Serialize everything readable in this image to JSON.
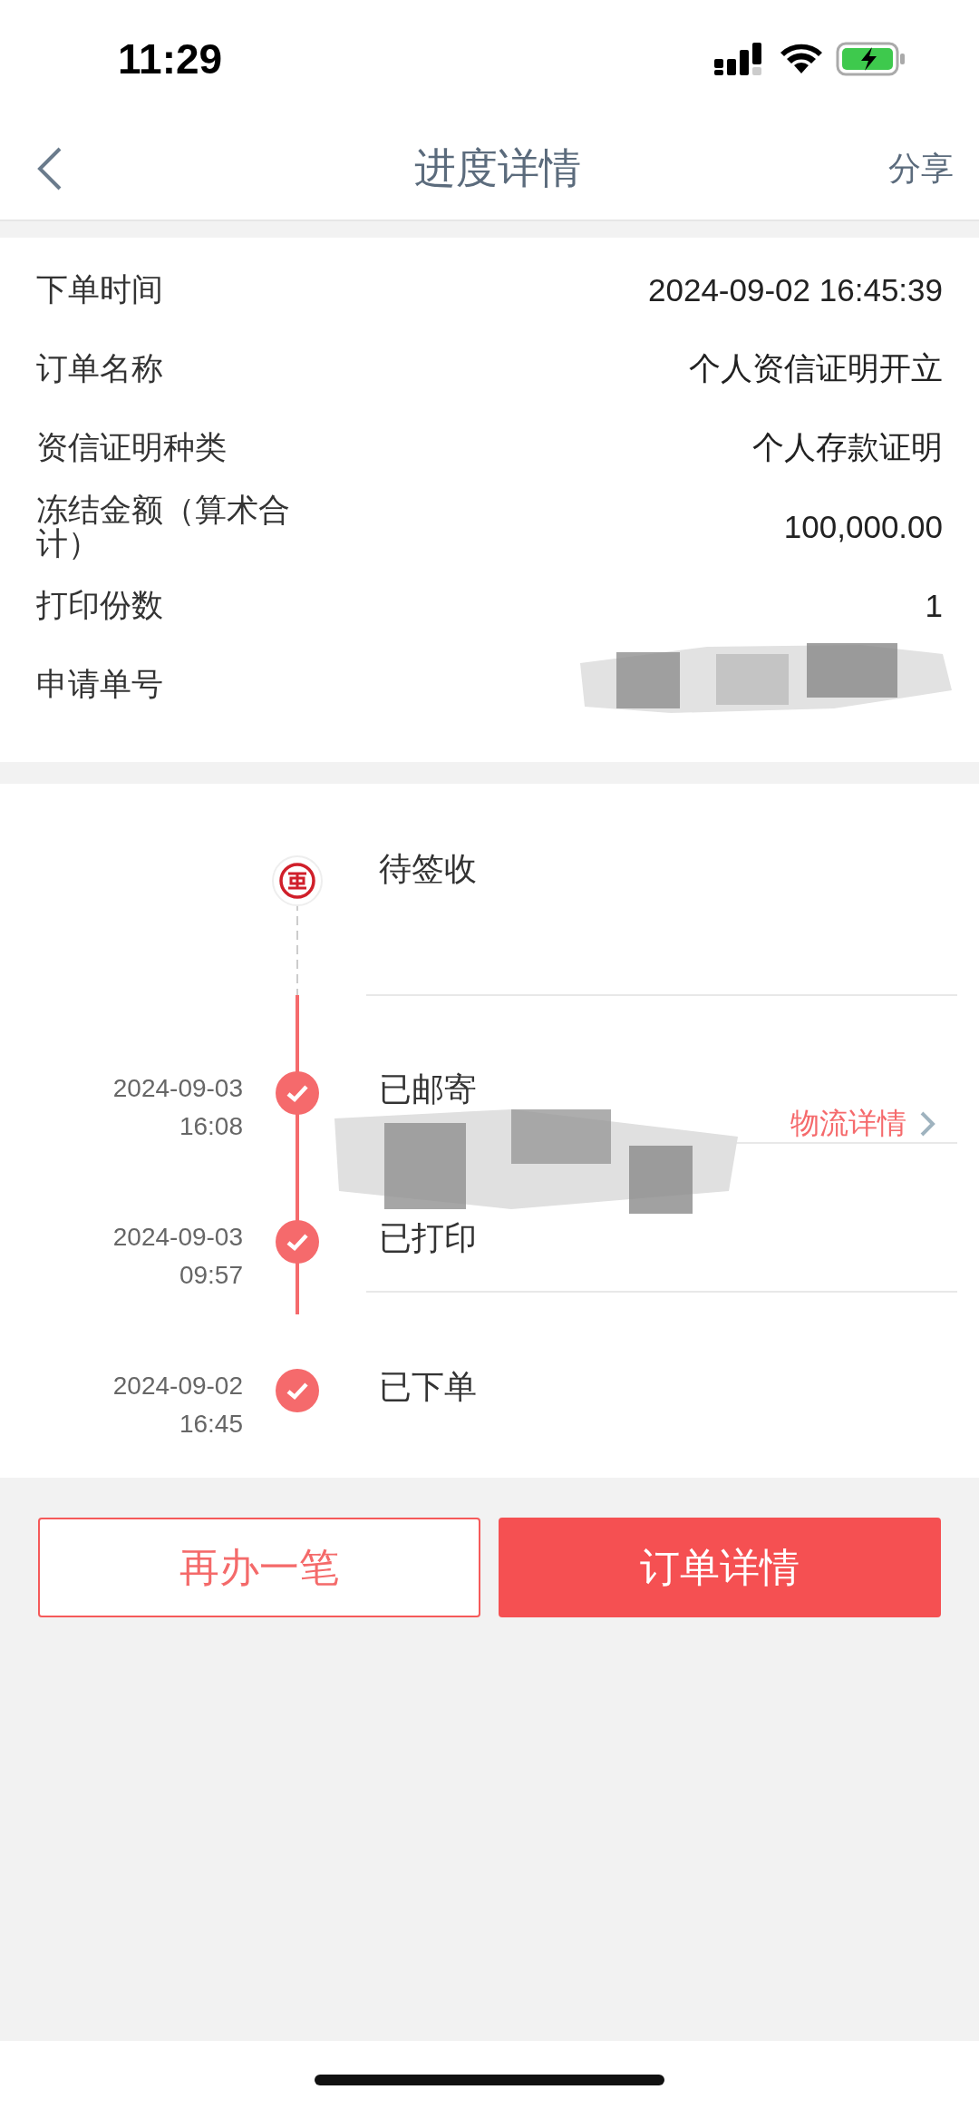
{
  "status_bar": {
    "time": "11:29"
  },
  "nav": {
    "title": "进度详情",
    "action": "分享"
  },
  "info_rows": [
    {
      "label": "下单时间",
      "value": "2024-09-02 16:45:39"
    },
    {
      "label": "订单名称",
      "value": "个人资信证明开立"
    },
    {
      "label": "资信证明种类",
      "value": "个人存款证明"
    },
    {
      "label": "冻结金额（算术合计）",
      "value": "100,000.00"
    },
    {
      "label": "打印份数",
      "value": "1"
    },
    {
      "label": "申请单号",
      "redacted": true
    }
  ],
  "timeline": [
    {
      "kind": "pending",
      "status": "待签收"
    },
    {
      "kind": "done",
      "date": "2024-09-03",
      "time": "16:08",
      "status": "已邮寄",
      "redacted": true,
      "link": "物流详情"
    },
    {
      "kind": "done",
      "date": "2024-09-03",
      "time": "09:57",
      "status": "已打印"
    },
    {
      "kind": "done",
      "date": "2024-09-02",
      "time": "16:45",
      "status": "已下单"
    }
  ],
  "buttons": [
    {
      "kind": "outline",
      "label": "再办一笔"
    },
    {
      "kind": "filled",
      "label": "订单详情"
    }
  ]
}
